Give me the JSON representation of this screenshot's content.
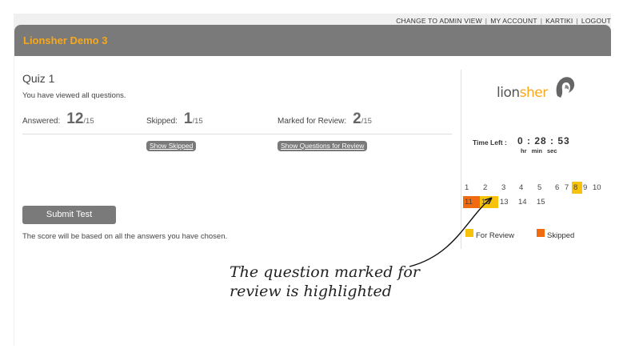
{
  "top_links": [
    "CHANGE TO ADMIN VIEW",
    "MY ACCOUNT",
    "KARTIKI",
    "LOGOUT"
  ],
  "header": {
    "title": "Lionsher Demo 3"
  },
  "quiz": {
    "title": "Quiz 1",
    "viewed_text": "You have viewed all questions.",
    "answered": {
      "label": "Answered:",
      "value": "12",
      "total": "/15"
    },
    "skipped": {
      "label": "Skipped:",
      "value": "1",
      "total": "/15"
    },
    "review": {
      "label": "Marked for Review:",
      "value": "2",
      "total": "/15"
    },
    "show_skipped": "Show Skipped",
    "show_review": "Show Questions for Review",
    "submit": "Submit Test",
    "score_note": "The score will be based on all the answers you have chosen."
  },
  "sidebar": {
    "logo_text_a": "lion",
    "logo_text_b": "sher",
    "time_left_label": "Time Left :",
    "time": "0 : 28 : 53",
    "units": "hr min sec",
    "questions": [
      {
        "n": "1",
        "state": "answered"
      },
      {
        "n": "2",
        "state": "answered"
      },
      {
        "n": "3",
        "state": "answered"
      },
      {
        "n": "4",
        "state": "answered"
      },
      {
        "n": "5",
        "state": "answered"
      },
      {
        "n": "6",
        "state": "answered"
      },
      {
        "n": "7",
        "state": "answered"
      },
      {
        "n": "8",
        "state": "review"
      },
      {
        "n": "9",
        "state": "answered"
      },
      {
        "n": "10",
        "state": "answered"
      },
      {
        "n": "11",
        "state": "skipped"
      },
      {
        "n": "12",
        "state": "review"
      },
      {
        "n": "13",
        "state": "answered"
      },
      {
        "n": "14",
        "state": "answered"
      },
      {
        "n": "15",
        "state": "answered"
      }
    ],
    "legend_review": "For Review",
    "legend_skipped": "Skipped",
    "colors": {
      "review": "#f7c20a",
      "skipped": "#f06a0f",
      "accent": "#f7a81b"
    }
  },
  "annotation": {
    "line1": "The question marked for",
    "line2": "review is highlighted"
  }
}
